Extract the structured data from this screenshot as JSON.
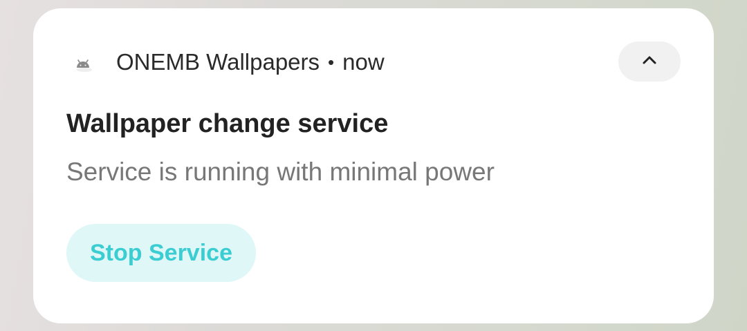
{
  "notification": {
    "app_name": "ONEMB Wallpapers",
    "separator": "•",
    "time": "now",
    "app_icon": "android-icon",
    "expand_icon": "chevron-up-icon",
    "title": "Wallpaper change service",
    "body": "Service is running with minimal power",
    "actions": [
      {
        "label": "Stop Service"
      }
    ]
  },
  "colors": {
    "card_background": "#ffffff",
    "action_text": "#3bcdd2",
    "action_background": "#e0f7f8",
    "title_text": "#222222",
    "body_text": "#777777"
  }
}
